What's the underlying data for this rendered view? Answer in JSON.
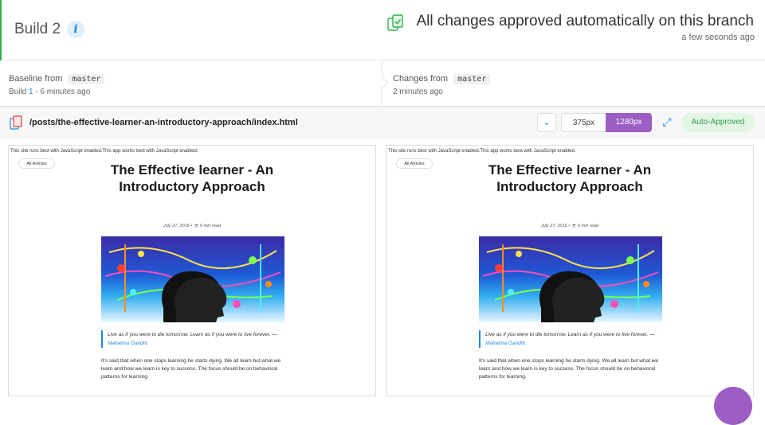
{
  "header": {
    "build_title": "Build 2",
    "info_symbol": "i",
    "status_text": "All changes approved automatically on this branch",
    "status_time": "a few seconds ago",
    "accent_color": "#2bb34a"
  },
  "compare": {
    "baseline_label": "Baseline from",
    "baseline_branch": "master",
    "baseline_build_prefix": "Build ",
    "baseline_build_number": "1",
    "baseline_build_suffix": " - 6 minutes ago",
    "changes_label": "Changes from",
    "changes_branch": "master",
    "changes_time": "2 minutes ago"
  },
  "snapshot": {
    "path": "/posts/the-effective-learner-an-introductory-approach/index.html",
    "viewport_options": [
      "375px",
      "1280px"
    ],
    "selected_viewport": "1280px",
    "status_badge": "Auto-Approved",
    "dropdown_icon": "chevron-down-icon",
    "expand_icon": "expand-icon"
  },
  "page_preview": {
    "js_note": "This site runs best with JavaScript enabled.This app works best with JavaScript enabled.",
    "all_articles": "All Articles",
    "title": "The Effective learner - An Introductory Approach",
    "meta": "July 27, 2016 • ☕ 6 min read",
    "quote_text": "Live as if you were to die tomorrow. Learn as if you were to live forever. — ",
    "quote_author": "Mahatma Gandhi.",
    "paragraph": "It's said that when one stops learning he starts dying. We all learn but what we learn and how we learn is key to success. The focus should be on behavioral patterns for learning."
  }
}
